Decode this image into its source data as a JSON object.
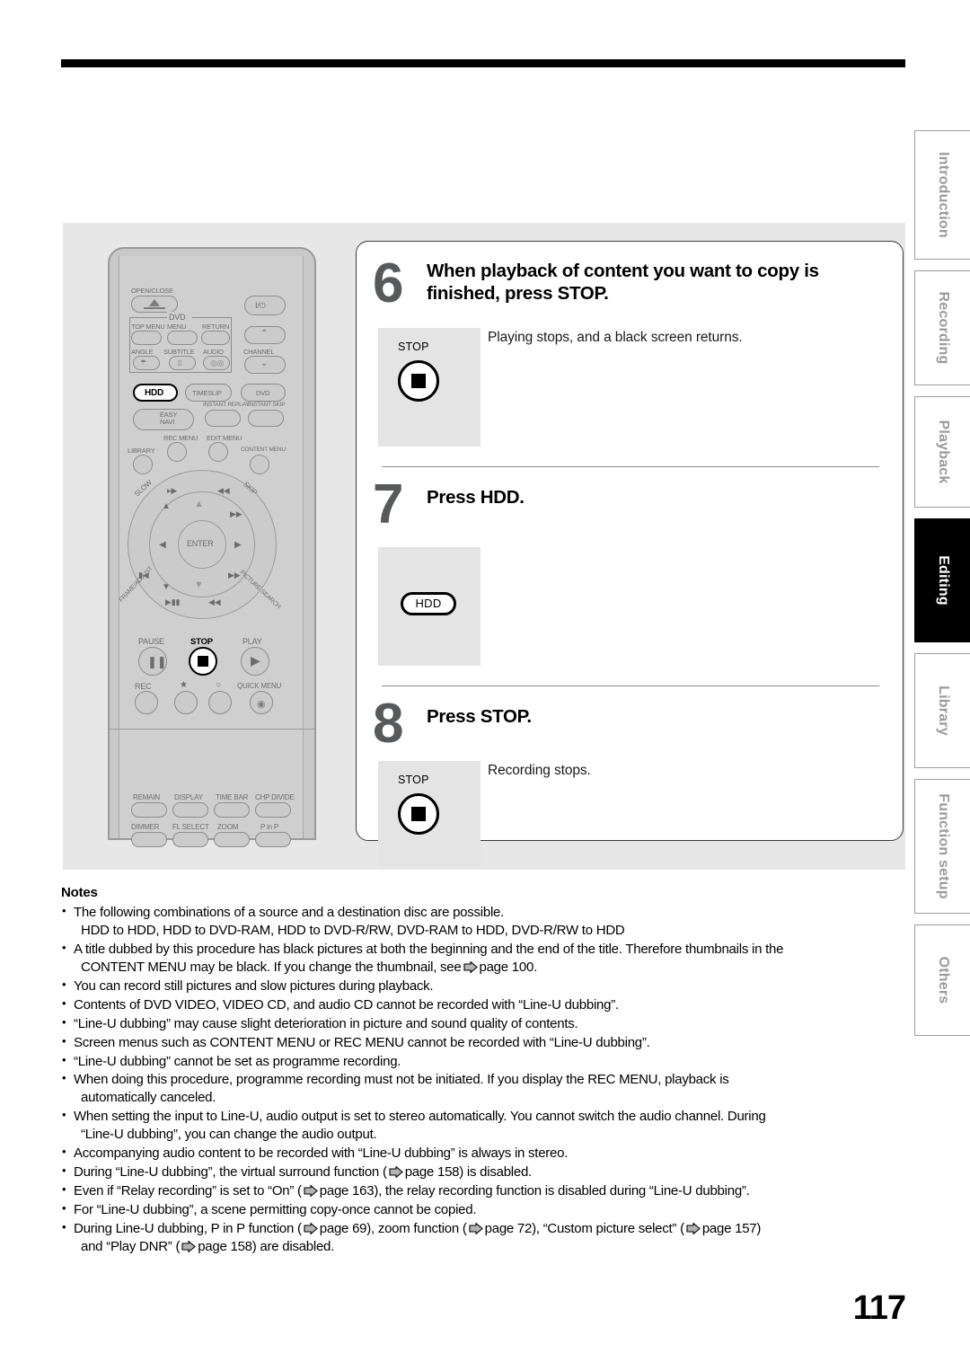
{
  "page": {
    "number": "117"
  },
  "illustration": {
    "name": "remote-control",
    "labels": {
      "open_close": "OPEN/CLOSE",
      "power": "I/⏻",
      "dvd_group": "DVD",
      "top_menu": "TOP MENU",
      "menu": "MENU",
      "return": "RETURN",
      "angle": "ANGLE",
      "subtitle": "SUBTITLE",
      "audio": "AUDIO",
      "channel": "CHANNEL",
      "hdd": "HDD",
      "timeslip": "TIMESLIP",
      "dvd": "DVD",
      "easy_navi": "EASY\nNAVI",
      "instant_replay": "INSTANT REPLAY",
      "instant_skip": "INSTANT SKIP",
      "rec_menu": "REC MENU",
      "edit_menu": "EDIT MENU",
      "library": "LIBRARY",
      "content_menu": "CONTENT MENU",
      "slow": "SLOW",
      "skip": "SKIP",
      "frame_adjust": "FRAME/ADJUST",
      "picture_search": "PICTURE SEARCH",
      "enter": "ENTER",
      "pause": "PAUSE",
      "stop": "STOP",
      "play": "PLAY",
      "rec": "REC",
      "star": "★",
      "circle": "○",
      "quick_menu": "QUICK MENU",
      "remain": "REMAIN",
      "display": "DISPLAY",
      "time_bar": "TIME BAR",
      "chp_divide": "CHP DIVIDE",
      "dimmer": "DIMMER",
      "fl_select": "FL SELECT",
      "zoom": "ZOOM",
      "p_in_p": "P in P"
    },
    "highlighted_buttons": [
      "HDD",
      "STOP"
    ]
  },
  "steps": [
    {
      "number": "6",
      "title": "When playback of content you want to copy is finished, press STOP.",
      "description": "Playing stops, and a black screen returns.",
      "key": {
        "type": "stop",
        "label": "STOP"
      }
    },
    {
      "number": "7",
      "title": "Press HDD.",
      "description": "",
      "key": {
        "type": "hdd",
        "label": "HDD"
      }
    },
    {
      "number": "8",
      "title": "Press STOP.",
      "description": "Recording stops.",
      "key": {
        "type": "stop",
        "label": "STOP"
      }
    }
  ],
  "notes": {
    "heading": "Notes",
    "items": [
      {
        "line1": "The following combinations of a source and a destination disc are possible.",
        "line2": "HDD to HDD, HDD to DVD-RAM, HDD to DVD-R/RW, DVD-RAM to HDD, DVD-R/RW to HDD"
      },
      {
        "line1": "A title dubbed by this procedure has black pictures at both the beginning and the end of the title. Therefore thumbnails in the",
        "line2a": "CONTENT MENU may be black. If you change the thumbnail, see",
        "line2b": "page 100."
      },
      {
        "line1": "You can record still pictures and slow pictures during playback."
      },
      {
        "line1": "Contents of DVD VIDEO, VIDEO CD, and audio CD cannot be recorded with “Line-U dubbing”."
      },
      {
        "line1": "“Line-U dubbing” may cause slight deterioration in picture and sound quality of contents."
      },
      {
        "line1": "Screen menus such as CONTENT MENU or REC MENU cannot be recorded with “Line-U dubbing”."
      },
      {
        "line1": "“Line-U dubbing” cannot be set as programme recording."
      },
      {
        "line1": "When doing this procedure, programme recording must not be initiated. If you display the REC MENU, playback is",
        "line2": "automatically canceled."
      },
      {
        "line1": "When setting the input to Line-U, audio output is set to stereo automatically. You cannot switch the audio channel. During",
        "line2": "“Line-U dubbing”, you can change the audio output."
      },
      {
        "line1": "Accompanying audio content to be recorded with “Line-U dubbing” is always in stereo."
      },
      {
        "pre": "During “Line-U dubbing”, the virtual surround function (",
        "post": "page 158) is disabled."
      },
      {
        "pre": "Even if “Relay recording” is set to “On” (",
        "post": "page 163), the relay recording function is disabled during “Line-U dubbing”."
      },
      {
        "line1": "For “Line-U dubbing”, a scene permitting copy-once cannot be copied."
      },
      {
        "multi_pre": "During Line-U dubbing, P in P function (",
        "multi_1": "page 69), zoom function (",
        "multi_2": "page 72), “Custom picture select” (",
        "multi_3": "page 157)",
        "multi_4": "and “Play DNR” (",
        "multi_5": "page 158) are disabled."
      }
    ]
  },
  "tabs": [
    {
      "label": "Introduction",
      "active": false
    },
    {
      "label": "Recording",
      "active": false
    },
    {
      "label": "Playback",
      "active": false
    },
    {
      "label": "Editing",
      "active": true
    },
    {
      "label": "Library",
      "active": false
    },
    {
      "label": "Function setup",
      "active": false
    },
    {
      "label": "Others",
      "active": false
    }
  ],
  "colors": {
    "step_number": "#58595b",
    "key_box_bg": "#e4e4e4",
    "panel_bg": "#e7e7e7",
    "tab_inactive_text": "#9a9a9a",
    "tab_active_bg": "#000000"
  }
}
